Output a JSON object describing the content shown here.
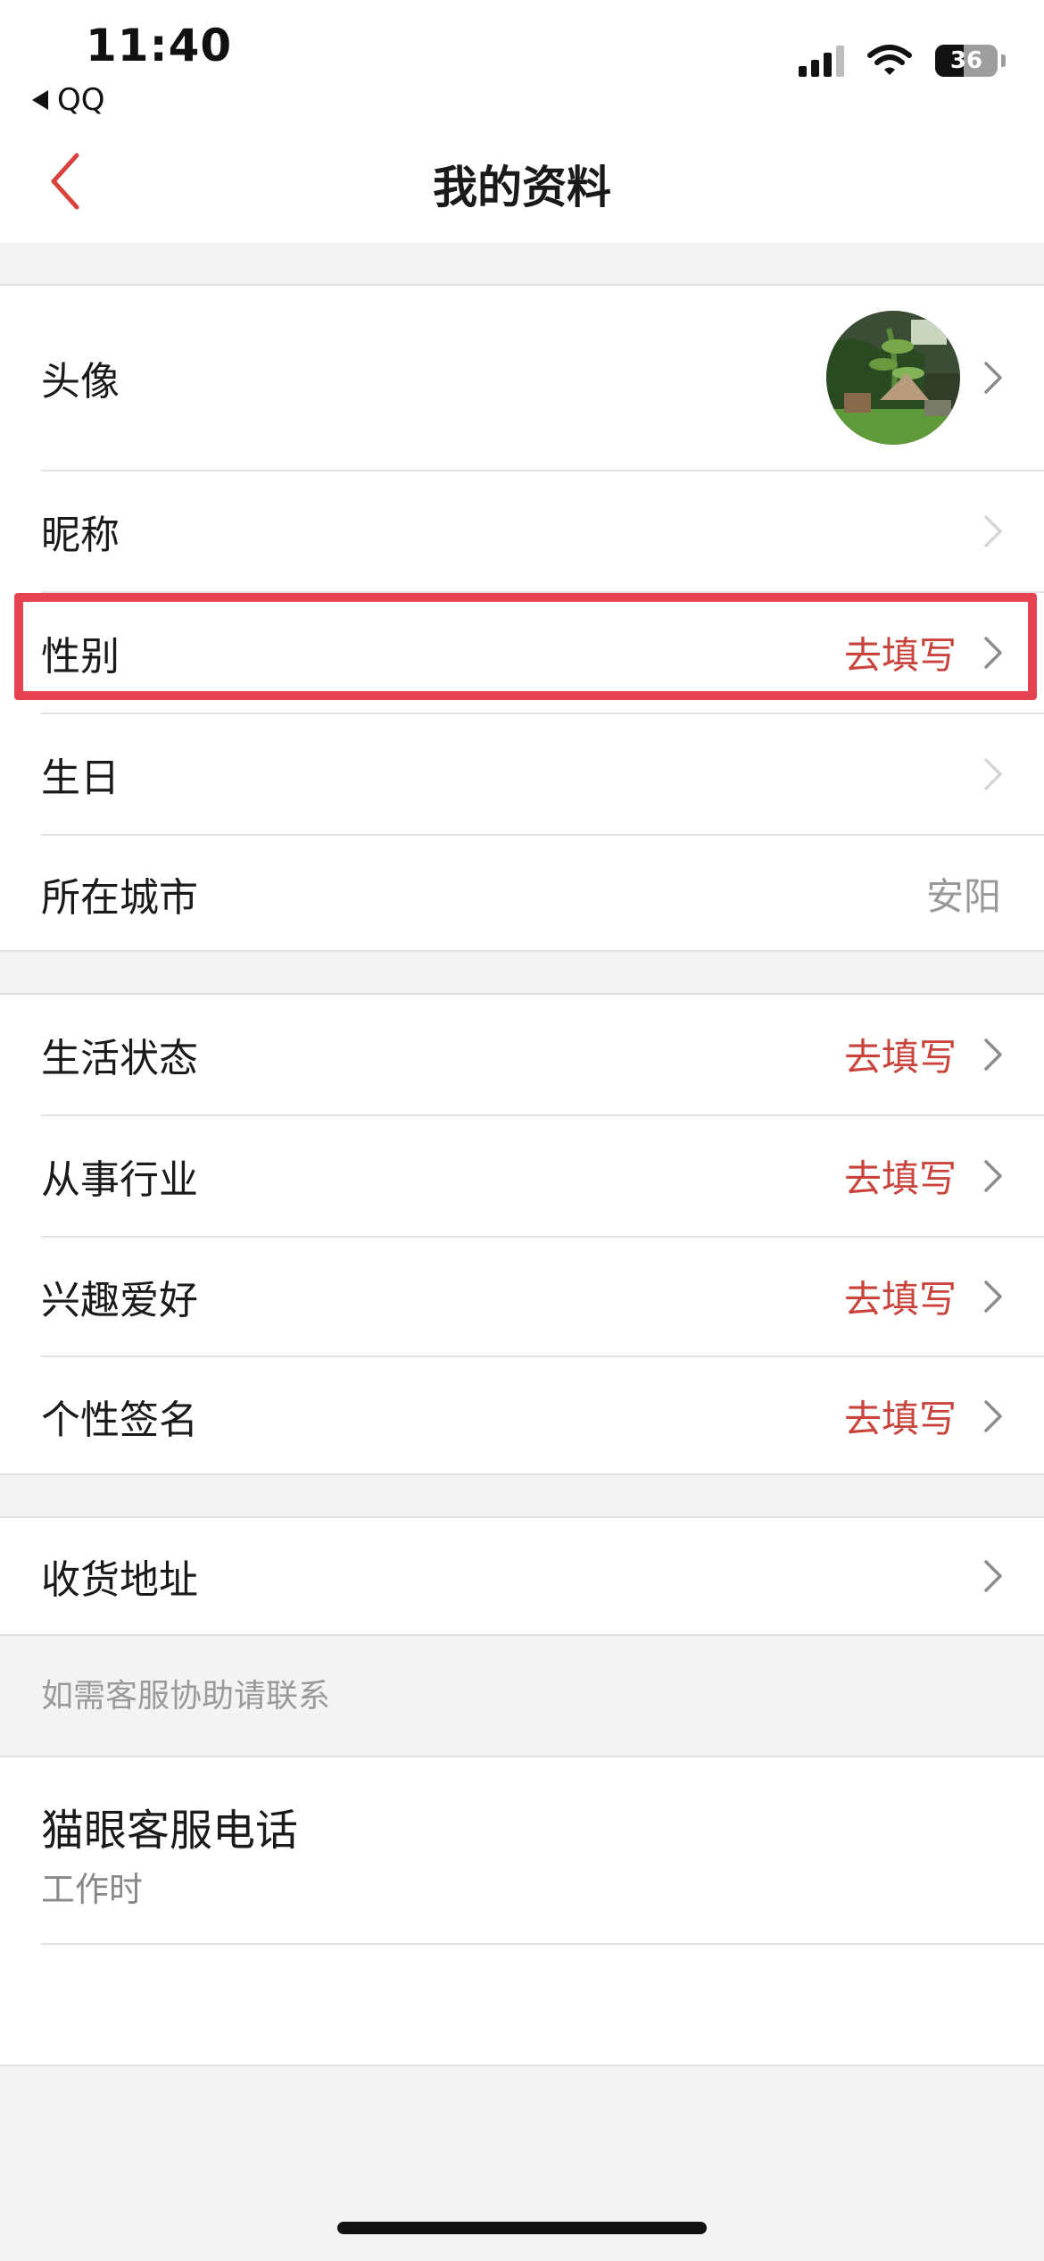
{
  "status_bar": {
    "time": "11:40",
    "back_app": "QQ",
    "battery": "36"
  },
  "nav": {
    "title": "我的资料"
  },
  "profile": {
    "avatar": {
      "label": "头像"
    },
    "nickname": {
      "label": "昵称"
    },
    "gender": {
      "label": "性别",
      "value": "去填写"
    },
    "birthday": {
      "label": "生日"
    },
    "city": {
      "label": "所在城市",
      "value": "安阳"
    }
  },
  "more": {
    "life_status": {
      "label": "生活状态",
      "value": "去填写"
    },
    "industry": {
      "label": "从事行业",
      "value": "去填写"
    },
    "hobbies": {
      "label": "兴趣爱好",
      "value": "去填写"
    },
    "signature": {
      "label": "个性签名",
      "value": "去填写"
    }
  },
  "address": {
    "label": "收货地址"
  },
  "support": {
    "hint": "如需客服协助请联系",
    "phone_title": "猫眼客服电话",
    "phone_sub": "工作时"
  },
  "colors": {
    "accent": "#c8443c",
    "highlight_box": "#e5434f",
    "background": "#f3f3f3"
  }
}
